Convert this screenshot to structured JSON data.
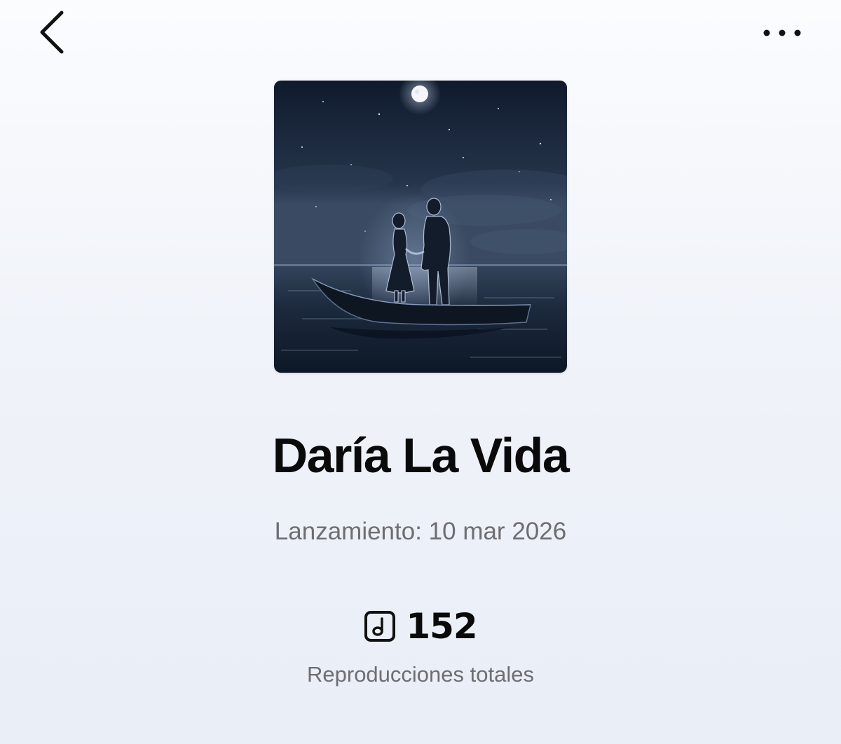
{
  "track": {
    "title": "Daría La Vida",
    "release": "Lanzamiento: 10 mar 2026",
    "plays_count": "152",
    "plays_label": "Reproducciones totales"
  },
  "icons": {
    "back": "chevron-left-icon",
    "more": "more-horizontal-icon",
    "plays": "music-note-square-icon"
  },
  "colors": {
    "title_text": "#0a0a0a",
    "secondary_text": "#6e6e72",
    "background_top": "#fbfcfe",
    "background_bottom": "#e9eef7",
    "night_sky": "#1b2638"
  }
}
